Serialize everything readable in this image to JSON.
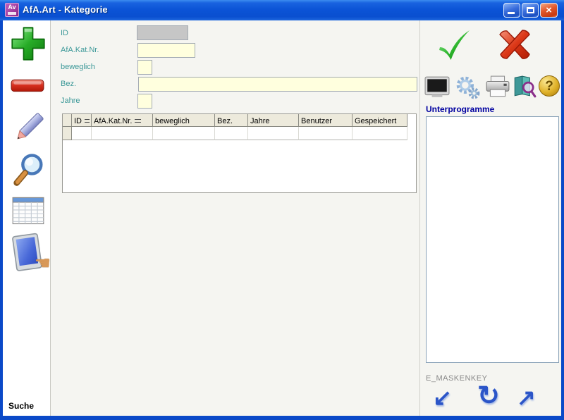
{
  "window": {
    "title": "AfA.Art - Kategorie",
    "app_icon_text": "Av"
  },
  "titlebar": {
    "close_glyph": "×"
  },
  "sidebar": {
    "footer_label": "Suche"
  },
  "form": {
    "fields": [
      {
        "label": "ID",
        "value": ""
      },
      {
        "label": "AfA.Kat.Nr.",
        "value": ""
      },
      {
        "label": "beweglich",
        "value": ""
      },
      {
        "label": "Bez.",
        "value": ""
      },
      {
        "label": "Jahre",
        "value": ""
      }
    ]
  },
  "grid": {
    "columns": [
      {
        "label": "ID",
        "sorted": true
      },
      {
        "label": "AfA.Kat.Nr.",
        "sorted": true
      },
      {
        "label": "beweglich",
        "sorted": false
      },
      {
        "label": "Bez.",
        "sorted": false
      },
      {
        "label": "Jahre",
        "sorted": false
      },
      {
        "label": "Benutzer",
        "sorted": false
      },
      {
        "label": "Gespeichert",
        "sorted": false
      }
    ],
    "rows": [
      {
        "cells": [
          "",
          "",
          "",
          "",
          "",
          "",
          ""
        ]
      }
    ]
  },
  "right_panel": {
    "subprograms_label": "Unterprogramme",
    "subprograms_items": [],
    "maskenkey_label": "E_MASKENKEY",
    "arrows": [
      {
        "glyph": "↙"
      },
      {
        "glyph": "↻"
      },
      {
        "glyph": "↗"
      }
    ],
    "help_glyph": "?",
    "hand_glyph": "☚"
  },
  "colors": {
    "titlebar_blue": "#0B53D6",
    "window_border_blue": "#0A49C8",
    "label_teal": "#3D9999",
    "input_cream": "#FFFFDE",
    "readonly_gray": "#C6C6C6",
    "grid_header_beige": "#EDEADC",
    "section_label_blue": "#0000A0",
    "muted_gray": "#8A8A8A"
  }
}
